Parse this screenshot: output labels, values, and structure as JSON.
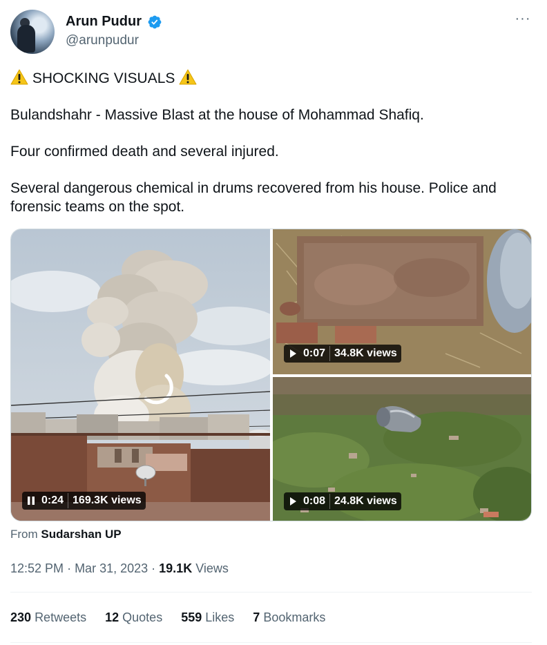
{
  "author": {
    "name": "Arun Pudur",
    "handle": "@arunpudur",
    "verified": true
  },
  "tweet": {
    "heading": "SHOCKING VISUALS",
    "line1": "Bulandshahr - Massive Blast at the house of Mohammad Shafiq.",
    "line2": "Four confirmed death and several injured.",
    "line3": "Several dangerous chemical in drums recovered from his house. Police and forensic teams on the spot."
  },
  "media": [
    {
      "time": "0:24",
      "views": "169.3K views",
      "state": "playing",
      "icon": "pause-icon"
    },
    {
      "time": "0:07",
      "views": "34.8K views",
      "state": "paused",
      "icon": "play-icon"
    },
    {
      "time": "0:08",
      "views": "24.8K views",
      "state": "paused",
      "icon": "play-icon"
    }
  ],
  "source": {
    "prefix": "From",
    "name": "Sudarshan UP"
  },
  "meta": {
    "time": "12:52 PM",
    "date": "Mar 31, 2023",
    "views_count": "19.1K",
    "views_label": "Views"
  },
  "stats": {
    "retweets_count": "230",
    "retweets_label": "Retweets",
    "quotes_count": "12",
    "quotes_label": "Quotes",
    "likes_count": "559",
    "likes_label": "Likes",
    "bookmarks_count": "7",
    "bookmarks_label": "Bookmarks"
  },
  "colors": {
    "text": "#0f1419",
    "secondary": "#536471",
    "verified_blue": "#1d9bf0",
    "divider": "#eff3f4"
  }
}
